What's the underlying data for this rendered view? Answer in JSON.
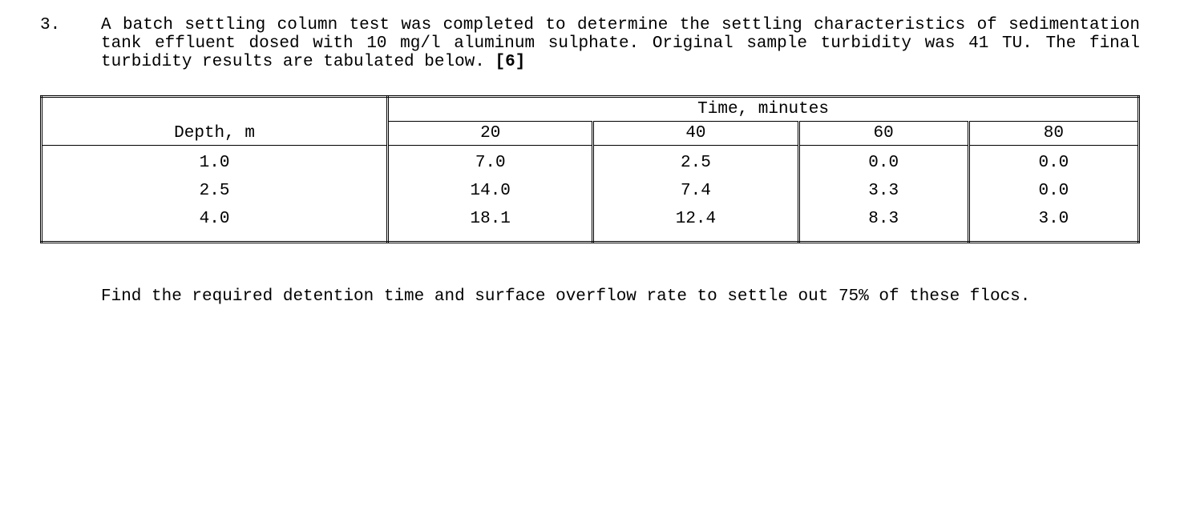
{
  "problem_number": "3.",
  "intro_text": "A batch settling column test was completed to determine the settling characteristics of sedimentation tank effluent dosed with 10 mg/l aluminum sulphate.  Original sample turbidity was 41 TU.  The final turbidity results are tabulated below.",
  "marks": "[6]",
  "table": {
    "depth_header": "Depth, m",
    "time_header": "Time, minutes",
    "time_cols": [
      "20",
      "40",
      "60",
      "80"
    ],
    "rows": [
      {
        "depth": "1.0",
        "vals": [
          "7.0",
          "2.5",
          "0.0",
          "0.0"
        ]
      },
      {
        "depth": "2.5",
        "vals": [
          "14.0",
          "7.4",
          "3.3",
          "0.0"
        ]
      },
      {
        "depth": "4.0",
        "vals": [
          "18.1",
          "12.4",
          "8.3",
          "3.0"
        ]
      }
    ]
  },
  "question_text": "Find the required detention time and surface overflow rate to settle out 75% of these flocs."
}
